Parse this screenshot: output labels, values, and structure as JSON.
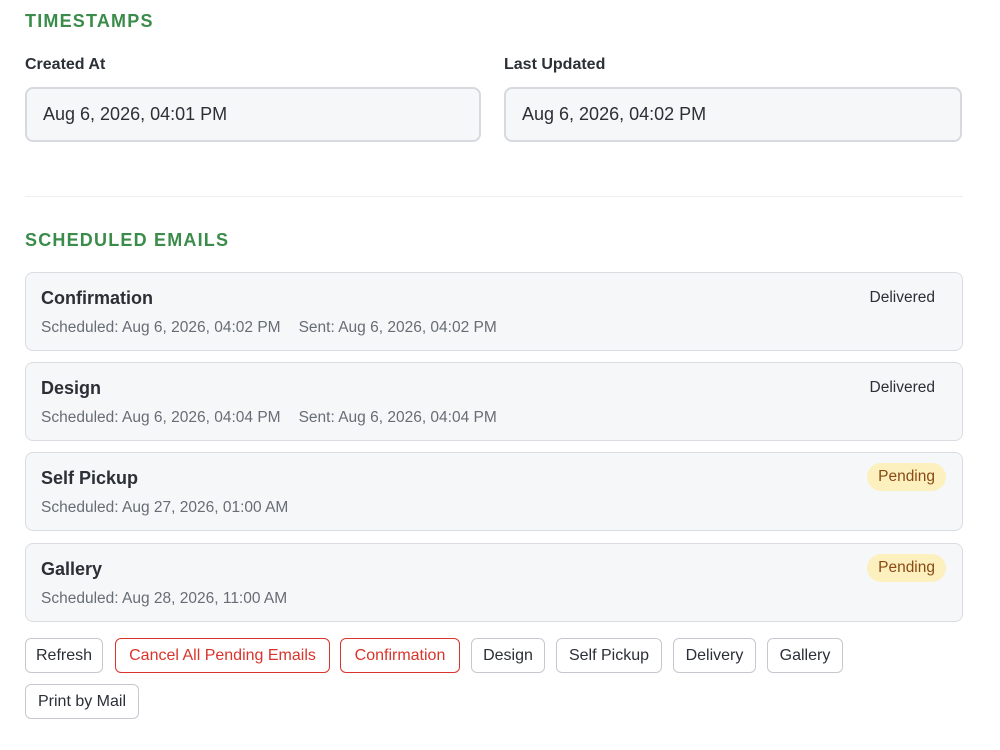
{
  "timestamps": {
    "title": "TIMESTAMPS",
    "created_label": "Created At",
    "created_value": "Aug 6, 2026, 04:01 PM",
    "updated_label": "Last Updated",
    "updated_value": "Aug 6, 2026, 04:02 PM"
  },
  "scheduled": {
    "title": "SCHEDULED EMAILS",
    "emails": [
      {
        "name": "Confirmation",
        "scheduled": "Scheduled: Aug 6, 2026, 04:02 PM",
        "sent": "Sent: Aug 6, 2026, 04:02 PM",
        "status": "Delivered"
      },
      {
        "name": "Design",
        "scheduled": "Scheduled: Aug 6, 2026, 04:04 PM",
        "sent": "Sent: Aug 6, 2026, 04:04 PM",
        "status": "Delivered"
      },
      {
        "name": "Self Pickup",
        "scheduled": "Scheduled: Aug 27, 2026, 01:00 AM",
        "status": "Pending"
      },
      {
        "name": "Gallery",
        "scheduled": "Scheduled: Aug 28, 2026, 11:00 AM",
        "status": "Pending"
      }
    ]
  },
  "actions": {
    "refresh": "Refresh",
    "cancel_all": "Cancel All Pending Emails",
    "confirmation": "Confirmation",
    "design": "Design",
    "self_pickup": "Self Pickup",
    "delivery": "Delivery",
    "gallery": "Gallery",
    "print_by_mail": "Print by Mail"
  },
  "colors": {
    "section_title": "#3b8c4a",
    "danger": "#d9342b",
    "pending_bg": "#fcf0bf",
    "pending_text": "#8a4a14"
  }
}
